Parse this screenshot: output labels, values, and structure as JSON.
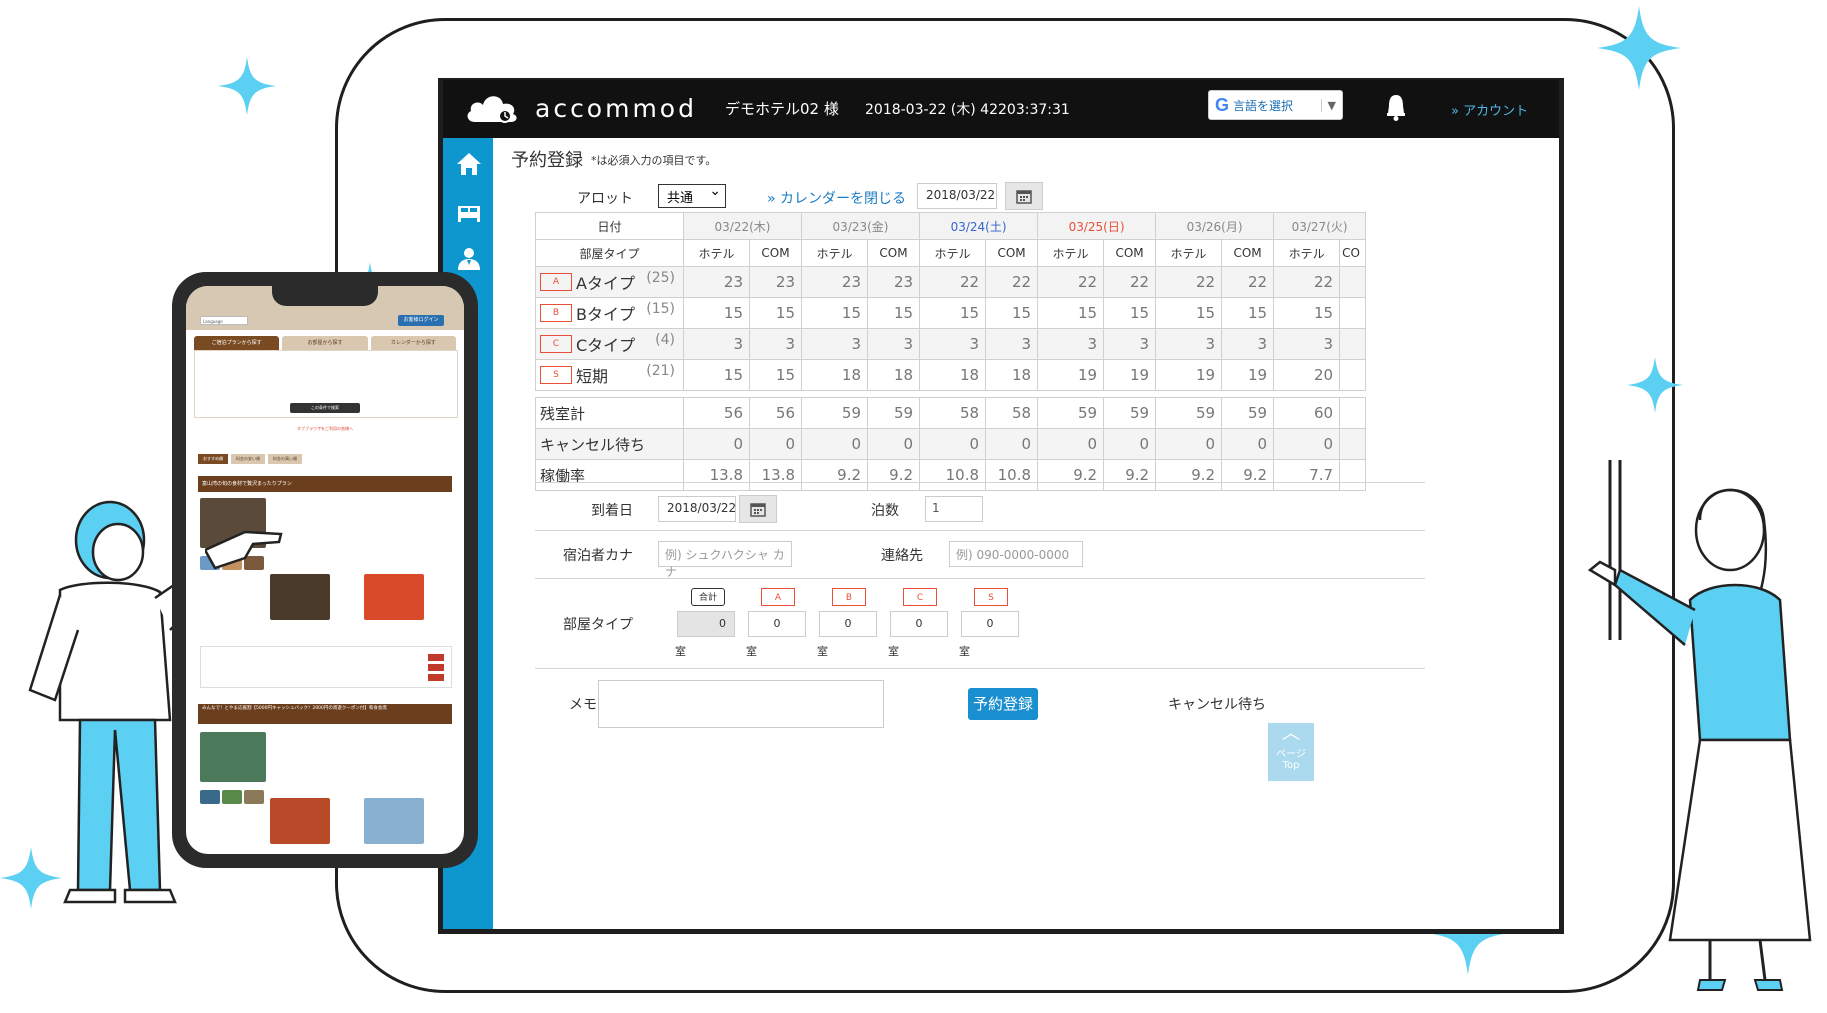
{
  "app": {
    "brand": "accommod",
    "hotel": "デモホテル02 様",
    "datetime": "2018-03-22 (木) 42203:37:31",
    "lang_label": "言語を選択",
    "account": "» アカウント"
  },
  "page": {
    "title": "予約登録",
    "note": "*は必須入力の項目です。",
    "allot_label": "アロット",
    "allot_value": "共通",
    "close_calendar": "» カレンダーを閉じる",
    "calendar_date": "2018/03/22"
  },
  "table": {
    "date_header": "日付",
    "roomtype_header": "部屋タイプ",
    "dates": [
      {
        "label": "03/22(木)",
        "kind": "weekday"
      },
      {
        "label": "03/23(金)",
        "kind": "weekday"
      },
      {
        "label": "03/24(土)",
        "kind": "sat"
      },
      {
        "label": "03/25(日)",
        "kind": "sun"
      },
      {
        "label": "03/26(月)",
        "kind": "weekday"
      },
      {
        "label": "03/27(火)",
        "kind": "weekday"
      }
    ],
    "sub_hotel": "ホテル",
    "sub_com": "COM",
    "room_rows": [
      {
        "tag": "A",
        "name": "Aタイプ",
        "count": "(25)",
        "values": [
          "23",
          "23",
          "23",
          "23",
          "22",
          "22",
          "22",
          "22",
          "22",
          "22",
          "22"
        ]
      },
      {
        "tag": "B",
        "name": "Bタイプ",
        "count": "(15)",
        "values": [
          "15",
          "15",
          "15",
          "15",
          "15",
          "15",
          "15",
          "15",
          "15",
          "15",
          "15"
        ]
      },
      {
        "tag": "C",
        "name": "Cタイプ",
        "count": "(4)",
        "values": [
          "3",
          "3",
          "3",
          "3",
          "3",
          "3",
          "3",
          "3",
          "3",
          "3",
          "3"
        ]
      },
      {
        "tag": "S",
        "name": "短期",
        "count": "(21)",
        "values": [
          "15",
          "15",
          "18",
          "18",
          "18",
          "18",
          "19",
          "19",
          "19",
          "19",
          "20"
        ]
      }
    ],
    "summary_rows": [
      {
        "name": "残室計",
        "values": [
          "56",
          "56",
          "59",
          "59",
          "58",
          "58",
          "59",
          "59",
          "59",
          "59",
          "60"
        ]
      },
      {
        "name": "キャンセル待ち",
        "values": [
          "0",
          "0",
          "0",
          "0",
          "0",
          "0",
          "0",
          "0",
          "0",
          "0",
          "0"
        ]
      },
      {
        "name": "稼働率",
        "values": [
          "13.8",
          "13.8",
          "9.2",
          "9.2",
          "10.8",
          "10.8",
          "9.2",
          "9.2",
          "9.2",
          "9.2",
          "7.7"
        ]
      }
    ]
  },
  "form": {
    "arrival_label": "到着日",
    "arrival_value": "2018/03/22",
    "nights_label": "泊数",
    "nights_value": "1",
    "guest_label": "宿泊者カナ",
    "guest_placeholder": "例) シュクハクシャ カナ",
    "contact_label": "連絡先",
    "contact_placeholder": "例) 090-0000-0000",
    "roomtype_label": "部屋タイプ",
    "room_tags": [
      "合計",
      "A",
      "B",
      "C",
      "S"
    ],
    "room_values": [
      "0",
      "0",
      "0",
      "0",
      "0"
    ],
    "room_unit": "室",
    "memo_label": "メモ",
    "submit": "予約登録",
    "waitlist": "キャンセル待ち",
    "page_top": "ページ Top"
  },
  "phone": {
    "lang": "Language",
    "login": "お客様ログイン",
    "tabs": [
      "ご宿泊プランから探す",
      "お部屋から探す",
      "カレンダーから探す"
    ],
    "search": "この条件で検索",
    "notice": "タブブラウザをご利用の皆様へ",
    "sort_tabs": [
      "おすすめ順",
      "料金の安い順",
      "料金の高い順"
    ],
    "plan1": "富山湾の旬の食材で贅沢まったりプラン",
    "plan2": "みんなで！とやま応援割【5000円キャッシュバック！2000円の周遊クーポン付】和食会席"
  },
  "colors": {
    "accent": "#0e96cf",
    "sparkle": "#5bd0f2",
    "topbar": "#111111",
    "primary_button": "#1a8fd0",
    "sunday": "#e8503a",
    "saturday": "#3366cc",
    "phone_brown": "#6b3f1d"
  }
}
